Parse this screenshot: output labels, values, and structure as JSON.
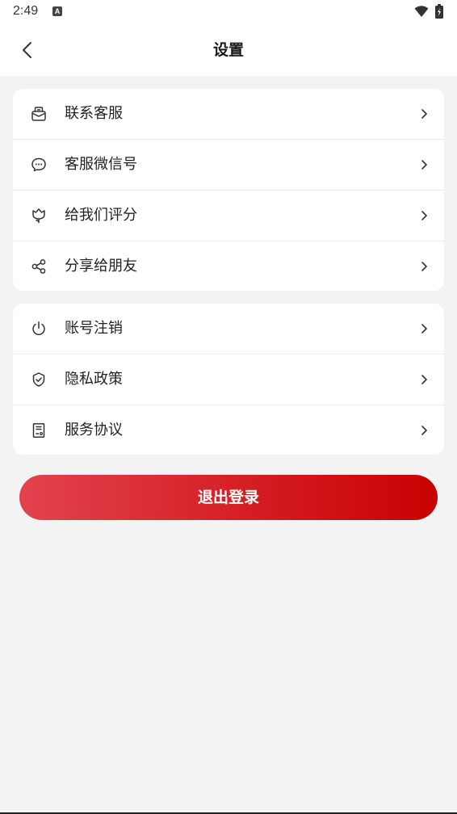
{
  "status_bar": {
    "time": "2:49",
    "notification_icon": "A"
  },
  "header": {
    "title": "设置",
    "back_icon": "chevron-left-icon"
  },
  "groups": [
    {
      "items": [
        {
          "label": "联系客服",
          "icon": "customer-service-icon"
        },
        {
          "label": "客服微信号",
          "icon": "chat-bubble-icon"
        },
        {
          "label": "给我们评分",
          "icon": "flower-rating-icon"
        },
        {
          "label": "分享给朋友",
          "icon": "share-icon"
        }
      ]
    },
    {
      "items": [
        {
          "label": "账号注销",
          "icon": "power-icon"
        },
        {
          "label": "隐私政策",
          "icon": "shield-check-icon"
        },
        {
          "label": "服务协议",
          "icon": "document-icon"
        }
      ]
    }
  ],
  "logout_label": "退出登录",
  "colors": {
    "accent_start": "#e2434f",
    "accent_end": "#c80202",
    "background": "#f3f3f3"
  }
}
